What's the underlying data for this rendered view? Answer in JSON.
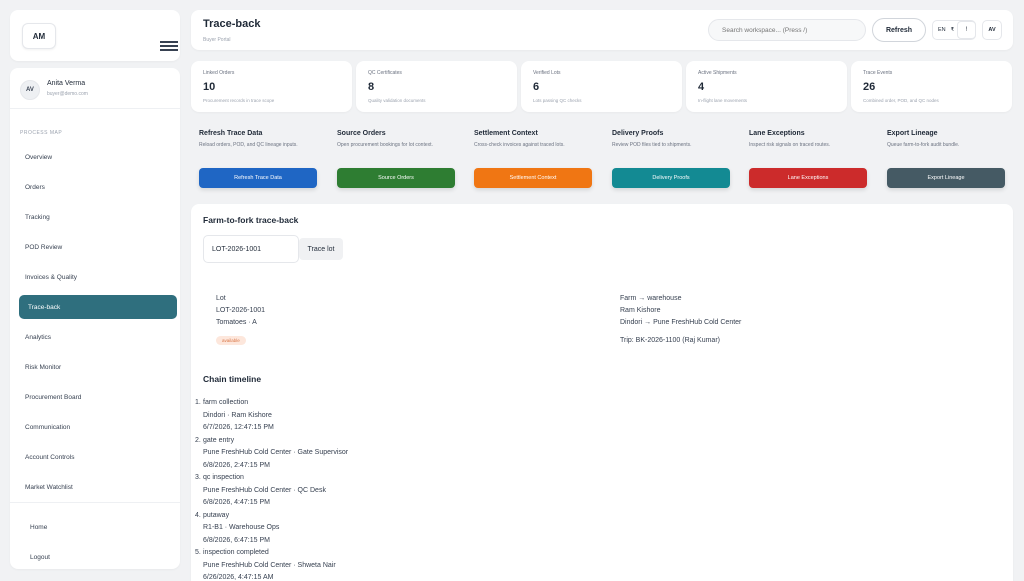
{
  "brand": {
    "initials": "AM"
  },
  "user": {
    "initials": "AV",
    "name": "Anita Verma",
    "email": "buyer@demo.com"
  },
  "sidebar": {
    "section_label": "PROCESS MAP",
    "items": [
      {
        "label": "Overview"
      },
      {
        "label": "Orders"
      },
      {
        "label": "Tracking"
      },
      {
        "label": "POD Review"
      },
      {
        "label": "Invoices & Quality"
      },
      {
        "label": "Trace-back"
      },
      {
        "label": "Analytics"
      },
      {
        "label": "Risk Monitor"
      },
      {
        "label": "Procurement Board"
      },
      {
        "label": "Communication"
      },
      {
        "label": "Account Controls"
      },
      {
        "label": "Market Watchlist"
      }
    ],
    "active_index": 5,
    "bottom": [
      {
        "label": "Home"
      },
      {
        "label": "Logout"
      }
    ]
  },
  "header": {
    "title": "Trace-back",
    "subtitle": "Buyer Portal",
    "search_placeholder": "Search workspace... (Press /)",
    "refresh_label": "Refresh",
    "lang": "EN",
    "currency": "₹",
    "notif": "!",
    "avatar": "AV"
  },
  "stats": [
    {
      "label": "Linked Orders",
      "value": "10",
      "desc": "Procurement records in trace scope"
    },
    {
      "label": "QC Certificates",
      "value": "8",
      "desc": "Quality validation documents"
    },
    {
      "label": "Verified Lots",
      "value": "6",
      "desc": "Lots passing QC checks"
    },
    {
      "label": "Active Shipments",
      "value": "4",
      "desc": "In-flight lane movements"
    },
    {
      "label": "Trace Events",
      "value": "26",
      "desc": "Combined order, POD, and QC nodes"
    }
  ],
  "actions": [
    {
      "title": "Refresh Trace Data",
      "desc": "Reload orders, POD, and QC lineage inputs.",
      "button": "Refresh Trace Data",
      "color": "#1f66c4"
    },
    {
      "title": "Source Orders",
      "desc": "Open procurement bookings for lot context.",
      "button": "Source Orders",
      "color": "#2e7d32"
    },
    {
      "title": "Settlement Context",
      "desc": "Cross-check invoices against traced lots.",
      "button": "Settlement Context",
      "color": "#f07613"
    },
    {
      "title": "Delivery Proofs",
      "desc": "Review POD files tied to shipments.",
      "button": "Delivery Proofs",
      "color": "#138a93"
    },
    {
      "title": "Lane Exceptions",
      "desc": "Inspect risk signals on traced routes.",
      "button": "Lane Exceptions",
      "color": "#cc2b2b"
    },
    {
      "title": "Export Lineage",
      "desc": "Queue farm-to-fork audit bundle.",
      "button": "Export Lineage",
      "color": "#455a64"
    }
  ],
  "trace": {
    "title": "Farm-to-fork trace-back",
    "lot_value": "LOT-2026-1001",
    "trace_button": "Trace lot",
    "lot_heading": "Lot",
    "lot_id": "LOT-2026-1001",
    "product": "Tomatoes · A",
    "status": "available",
    "route_heading": "Farm → warehouse",
    "farmer": "Ram Kishore",
    "route": "Dindori → Pune FreshHub Cold Center",
    "trip": "Trip: BK-2026-1100 (Raj Kumar)"
  },
  "timeline": {
    "title": "Chain timeline",
    "events": [
      {
        "num": "1.",
        "name": "farm collection",
        "where": "Dindori · Ram Kishore",
        "time": "6/7/2026, 12:47:15 PM"
      },
      {
        "num": "2.",
        "name": "gate entry",
        "where": "Pune FreshHub Cold Center · Gate Supervisor",
        "time": "6/8/2026, 2:47:15 PM"
      },
      {
        "num": "3.",
        "name": "qc inspection",
        "where": "Pune FreshHub Cold Center · QC Desk",
        "time": "6/8/2026, 4:47:15 PM"
      },
      {
        "num": "4.",
        "name": "putaway",
        "where": "R1-B1 · Warehouse Ops",
        "time": "6/8/2026, 6:47:15 PM"
      },
      {
        "num": "5.",
        "name": "inspection completed",
        "where": "Pune FreshHub Cold Center · Shweta Nair",
        "time": "6/26/2026, 4:47:15 AM"
      }
    ]
  }
}
